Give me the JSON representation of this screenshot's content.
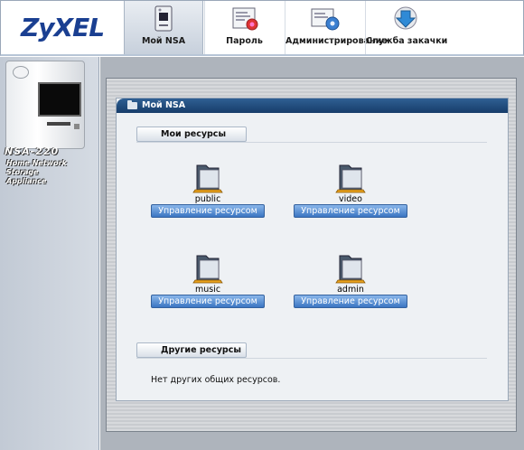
{
  "brand": {
    "logo_text": "ZyXEL"
  },
  "nav": {
    "tabs": [
      {
        "label": "Мой NSA",
        "icon": "nas-device-icon",
        "active": true
      },
      {
        "label": "Пароль",
        "icon": "password-certificate-icon",
        "active": false
      },
      {
        "label": "Администрирование",
        "icon": "admin-gear-icon",
        "active": false
      },
      {
        "label": "Служба закачки",
        "icon": "download-globe-icon",
        "active": false
      }
    ]
  },
  "sidebar": {
    "model": "NSA-220",
    "subtitle_line1": "Home Network Storage",
    "subtitle_line2": "Appliance"
  },
  "panel": {
    "title": "Мой NSA",
    "my_shares": {
      "title": "Мои ресурсы",
      "shares": [
        {
          "name": "public",
          "action": "Управление ресурсом"
        },
        {
          "name": "video",
          "action": "Управление ресурсом"
        },
        {
          "name": "music",
          "action": "Управление ресурсом"
        },
        {
          "name": "admin",
          "action": "Управление ресурсом"
        }
      ]
    },
    "other_shares": {
      "title": "Другие ресурсы",
      "empty_text": "Нет других общих ресурсов."
    }
  },
  "colors": {
    "logo": "#1a3f91",
    "panel_header": "#173d6a",
    "button": "#3b76c2"
  }
}
